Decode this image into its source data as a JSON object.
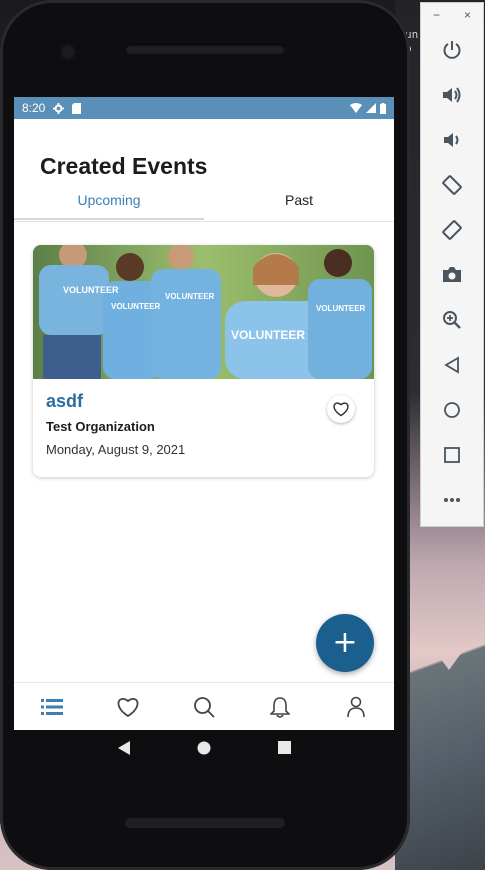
{
  "status_bar": {
    "time": "8:20"
  },
  "page": {
    "title": "Created Events"
  },
  "tabs": [
    {
      "label": "Upcoming",
      "active": true
    },
    {
      "label": "Past",
      "active": false
    }
  ],
  "event": {
    "name": "asdf",
    "organization": "Test Organization",
    "date": "Monday, August 9, 2021",
    "image_shirt_text": "VOLUNTEER"
  },
  "fab": {
    "label": "+"
  },
  "bottom_nav": [
    {
      "icon": "list-icon",
      "active": true
    },
    {
      "icon": "heart-icon",
      "active": false
    },
    {
      "icon": "search-icon",
      "active": false
    },
    {
      "icon": "bell-icon",
      "active": false
    },
    {
      "icon": "person-icon",
      "active": false
    }
  ],
  "emulator_toolbar": {
    "window_controls": [
      "−",
      "×"
    ],
    "buttons": [
      "power-icon",
      "volume-up-icon",
      "volume-down-icon",
      "rotate-left-icon",
      "rotate-right-icon",
      "camera-icon",
      "zoom-icon",
      "back-icon",
      "home-icon",
      "overview-icon",
      "more-icon"
    ]
  },
  "colors": {
    "accent": "#3b7fb3",
    "status_bar": "#5a8fb8",
    "fab": "#1a5f8e"
  }
}
